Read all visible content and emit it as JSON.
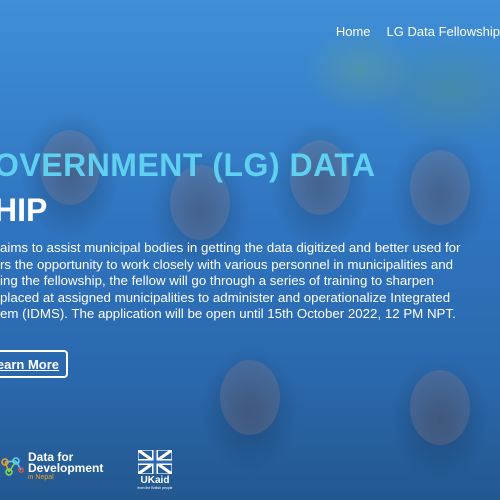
{
  "nav": {
    "items": [
      "Home",
      "LG Data Fellowship"
    ]
  },
  "hero": {
    "title": "OVERNMENT (LG) DATA",
    "subtitle": "HIP",
    "description_lines": [
      "aims to assist municipal bodies in getting the data digitized and better used for",
      "rs the opportunity to work closely with various personnel in municipalities and",
      "ing the fellowship, the fellow will go through a series of training to sharpen",
      "placed at assigned municipalities to administer and operationalize Integrated",
      "em (IDMS). The application will be open until 15th October 2022, 12 PM NPT."
    ],
    "cta_label": "Learn More"
  },
  "partners": {
    "dfd": {
      "line1": "Data for",
      "line2": "Development",
      "line3": "in Nepal"
    },
    "ukaid": {
      "label": "UKaid",
      "sub": "from the British people"
    }
  },
  "colors": {
    "title": "#5fd0f0",
    "text": "#ffffff",
    "accent": "#f0a020"
  }
}
